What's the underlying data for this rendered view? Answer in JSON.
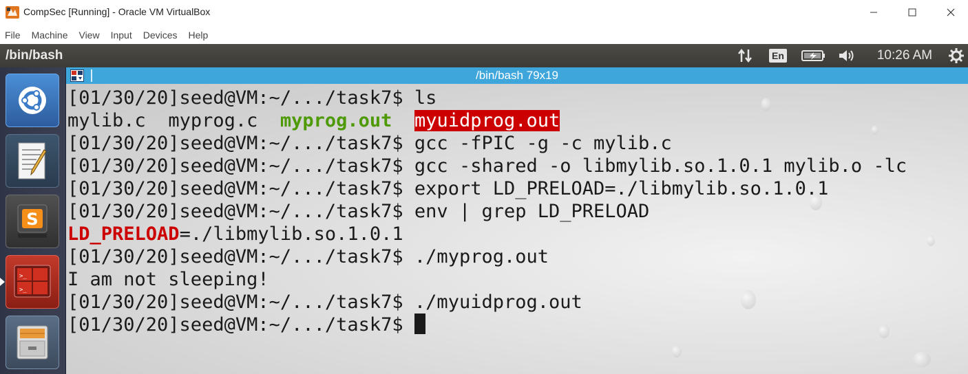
{
  "window": {
    "title": "CompSec [Running] - Oracle VM VirtualBox",
    "controls": {
      "minimize": "—",
      "maximize": "☐",
      "close": "✕"
    }
  },
  "menubar": [
    "File",
    "Machine",
    "View",
    "Input",
    "Devices",
    "Help"
  ],
  "panel": {
    "title": "/bin/bash",
    "language": "En",
    "clock": "10:26 AM",
    "icons": [
      "network-icon",
      "keyboard-language-icon",
      "battery-icon",
      "volume-icon",
      "settings-gear-icon"
    ]
  },
  "launcher": {
    "items": [
      "dash-icon",
      "text-editor-icon",
      "sublime-text-icon",
      "terminal-icon",
      "file-manager-icon"
    ],
    "active": "terminal-icon"
  },
  "terminal": {
    "title": "/bin/bash 79x19",
    "prompt": "[01/30/20]seed@VM:~/.../task7$ ",
    "lines": [
      {
        "type": "prompt",
        "command": "ls"
      },
      {
        "type": "ls",
        "files": [
          {
            "name": "mylib.c",
            "style": "plain"
          },
          {
            "name": "myprog.c",
            "style": "plain"
          },
          {
            "name": "myprog.out",
            "style": "green-bold"
          },
          {
            "name": "myuidprog.out",
            "style": "redbg"
          }
        ]
      },
      {
        "type": "prompt",
        "command": "gcc -fPIC -g -c mylib.c"
      },
      {
        "type": "prompt",
        "command": "gcc -shared -o libmylib.so.1.0.1 mylib.o -lc"
      },
      {
        "type": "prompt",
        "command": "export LD_PRELOAD=./libmylib.so.1.0.1"
      },
      {
        "type": "prompt",
        "command": "env | grep LD_PRELOAD"
      },
      {
        "type": "match",
        "highlight": "LD_PRELOAD",
        "rest": "=./libmylib.so.1.0.1"
      },
      {
        "type": "prompt",
        "command": "./myprog.out"
      },
      {
        "type": "output",
        "text": "I am not sleeping!"
      },
      {
        "type": "prompt",
        "command": "./myuidprog.out"
      },
      {
        "type": "prompt",
        "command": "",
        "cursor": true
      }
    ]
  },
  "colors": {
    "panel_bg": "#3c3b37",
    "term_tab_bg": "#3fa6dc",
    "exec_green": "#4e9a06",
    "setuid_red": "#cc0000"
  }
}
